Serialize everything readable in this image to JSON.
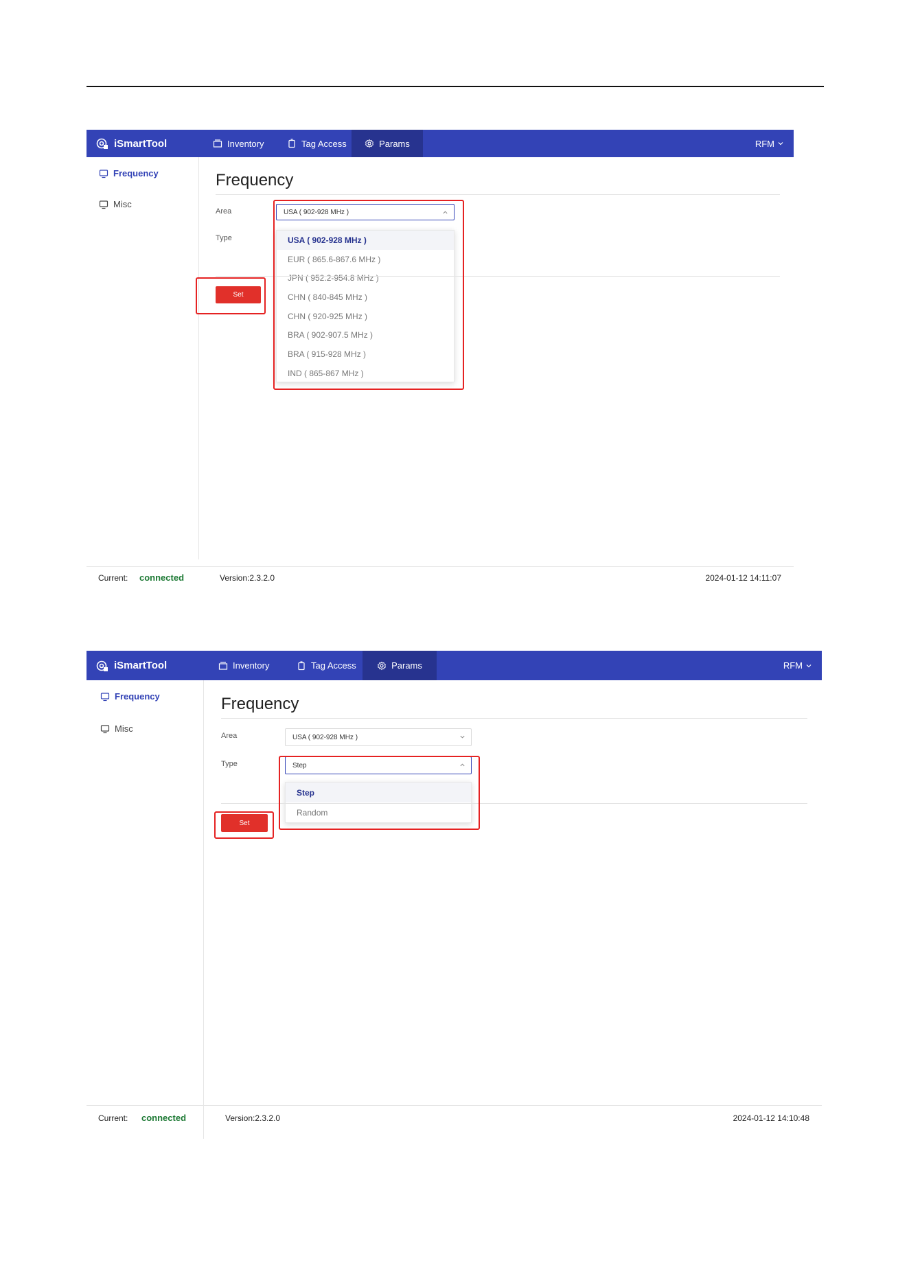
{
  "screens": [
    {
      "app_name": "iSmartTool",
      "nav_tabs": [
        "Inventory",
        "Tag Access",
        "Params"
      ],
      "active_tab": "Params",
      "device_menu": "RFM",
      "sidebar": [
        {
          "label": "Frequency",
          "active": true
        },
        {
          "label": "Misc",
          "active": false
        }
      ],
      "page_title": "Frequency",
      "area_label": "Area",
      "area_value": "USA ( 902-928 MHz )",
      "type_label": "Type",
      "open_dropdown": "area",
      "area_options": [
        "USA ( 902-928 MHz )",
        "EUR ( 865.6-867.6 MHz )",
        "JPN ( 952.2-954.8 MHz )",
        "CHN ( 840-845 MHz )",
        "CHN ( 920-925 MHz )",
        "BRA ( 902-907.5 MHz )",
        "BRA ( 915-928 MHz )",
        "IND ( 865-867 MHz )"
      ],
      "selected_option": "USA ( 902-928 MHz )",
      "set_button": "Set",
      "footer": {
        "current_label": "Current:",
        "status": "connected",
        "version": "Version:2.3.2.0",
        "timestamp": "2024-01-12 14:11:07"
      }
    },
    {
      "app_name": "iSmartTool",
      "nav_tabs": [
        "Inventory",
        "Tag Access",
        "Params"
      ],
      "active_tab": "Params",
      "device_menu": "RFM",
      "sidebar": [
        {
          "label": "Frequency",
          "active": true
        },
        {
          "label": "Misc",
          "active": false
        }
      ],
      "page_title": "Frequency",
      "area_label": "Area",
      "area_value": "USA ( 902-928 MHz )",
      "type_label": "Type",
      "type_value": "Step",
      "open_dropdown": "type",
      "type_options": [
        "Step",
        "Random"
      ],
      "selected_option": "Step",
      "set_button": "Set",
      "footer": {
        "current_label": "Current:",
        "status": "connected",
        "version": "Version:2.3.2.0",
        "timestamp": "2024-01-12 14:10:48"
      }
    }
  ],
  "colors": {
    "navbar": "#3343b6",
    "active_tab": "#27338f",
    "set_button": "#e1302a",
    "highlight_box": "#e52222",
    "connected": "#1e7a35"
  },
  "icons": [
    "app-logo-icon",
    "box-icon",
    "tag-icon",
    "gear-icon",
    "chevron-down-icon",
    "monitor-icon",
    "chevron-up-icon"
  ]
}
